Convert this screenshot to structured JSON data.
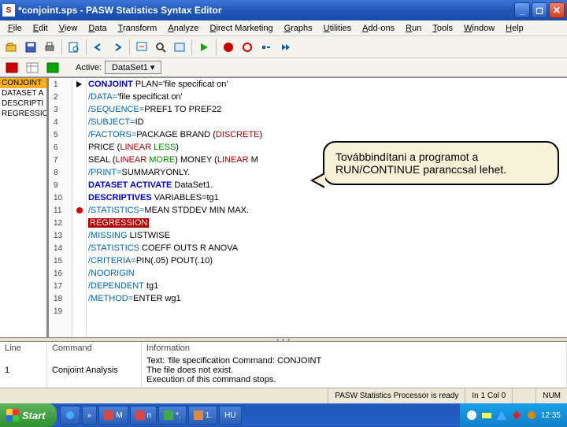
{
  "window": {
    "title": "*conjoint.sps - PASW Statistics Syntax Editor",
    "app_icon_letter": "S"
  },
  "menu": [
    "File",
    "Edit",
    "View",
    "Data",
    "Transform",
    "Analyze",
    "Direct Marketing",
    "Graphs",
    "Utilities",
    "Add-ons",
    "Run",
    "Tools",
    "Window",
    "Help"
  ],
  "toolbar2": {
    "active_label": "Active:",
    "dataset": "DataSet1 ▾"
  },
  "nav": {
    "items": [
      "CONJOINT",
      "DATASET A",
      "DESCRIPTI",
      "REGRESSIO"
    ],
    "selected_index": 0
  },
  "gutter_lines": [
    "1",
    "2",
    "3",
    "4",
    "5",
    "6",
    "7",
    "8",
    "9",
    "10",
    "11",
    "12",
    "13",
    "14",
    "15",
    "16",
    "17",
    "18",
    "19"
  ],
  "code": [
    {
      "indent": 0,
      "segments": [
        {
          "cls": "cmd",
          "t": "CONJOINT"
        },
        {
          "cls": "txt",
          "t": " PLAN='file specificat on'"
        }
      ],
      "marker": "arrow"
    },
    {
      "indent": 1,
      "segments": [
        {
          "cls": "sub",
          "t": "/DATA="
        },
        {
          "cls": "txt",
          "t": "'file specificat on'"
        }
      ]
    },
    {
      "indent": 1,
      "segments": [
        {
          "cls": "sub",
          "t": "/SEQUENCE="
        },
        {
          "cls": "txt",
          "t": "PREF1 TO PREF22"
        }
      ]
    },
    {
      "indent": 1,
      "segments": [
        {
          "cls": "sub",
          "t": "/SUBJECT="
        },
        {
          "cls": "txt",
          "t": "ID"
        }
      ]
    },
    {
      "indent": 1,
      "segments": [
        {
          "cls": "sub",
          "t": "/FACTORS="
        },
        {
          "cls": "txt",
          "t": "PACKAGE BRAND ("
        },
        {
          "cls": "kw",
          "t": "DISCRETE"
        },
        {
          "cls": "txt",
          "t": ")"
        }
      ]
    },
    {
      "indent": 2,
      "segments": [
        {
          "cls": "txt",
          "t": "PRICE ("
        },
        {
          "cls": "kw",
          "t": "LINEAR"
        },
        {
          "cls": "txt",
          "t": " "
        },
        {
          "cls": "val",
          "t": "LESS"
        },
        {
          "cls": "txt",
          "t": ")"
        }
      ]
    },
    {
      "indent": 2,
      "segments": [
        {
          "cls": "txt",
          "t": "SEAL ("
        },
        {
          "cls": "kw",
          "t": "LINEAR"
        },
        {
          "cls": "txt",
          "t": " "
        },
        {
          "cls": "val",
          "t": "MORE"
        },
        {
          "cls": "txt",
          "t": ") MONEY ("
        },
        {
          "cls": "kw",
          "t": "LINEAR"
        },
        {
          "cls": "txt",
          "t": " M"
        }
      ]
    },
    {
      "indent": 1,
      "segments": [
        {
          "cls": "sub",
          "t": "/PRINT="
        },
        {
          "cls": "txt",
          "t": "SUMMARYONLY."
        }
      ]
    },
    {
      "indent": 0,
      "segments": [
        {
          "cls": "cmd",
          "t": "DATASET ACTIVATE"
        },
        {
          "cls": "txt",
          "t": " DataSet1."
        }
      ]
    },
    {
      "indent": 0,
      "segments": [
        {
          "cls": "cmd",
          "t": "DESCRIPTIVES"
        },
        {
          "cls": "txt",
          "t": " VARIABLES=tg1"
        }
      ]
    },
    {
      "indent": 1,
      "segments": [
        {
          "cls": "sub",
          "t": "/STATISTICS="
        },
        {
          "cls": "txt",
          "t": "MEAN STDDEV MIN MAX."
        }
      ],
      "marker": "reddot"
    },
    {
      "indent": 0,
      "segments": [
        {
          "cls": "selred",
          "t": "REGRESSION"
        }
      ]
    },
    {
      "indent": 1,
      "segments": [
        {
          "cls": "sub",
          "t": "/MISSING"
        },
        {
          "cls": "txt",
          "t": " LISTWISE"
        }
      ]
    },
    {
      "indent": 1,
      "segments": [
        {
          "cls": "sub",
          "t": "/STATISTICS"
        },
        {
          "cls": "txt",
          "t": " COEFF OUTS R ANOVA"
        }
      ]
    },
    {
      "indent": 1,
      "segments": [
        {
          "cls": "sub",
          "t": "/CRITERIA="
        },
        {
          "cls": "txt",
          "t": "PIN(.05) POUT(.10)"
        }
      ]
    },
    {
      "indent": 1,
      "segments": [
        {
          "cls": "sub",
          "t": "/NOORIGIN"
        }
      ]
    },
    {
      "indent": 1,
      "segments": [
        {
          "cls": "sub",
          "t": "/DEPENDENT"
        },
        {
          "cls": "txt",
          "t": " tg1"
        }
      ]
    },
    {
      "indent": 1,
      "segments": [
        {
          "cls": "sub",
          "t": "/METHOD="
        },
        {
          "cls": "txt",
          "t": "ENTER wg1"
        }
      ]
    },
    {
      "indent": 0,
      "segments": []
    }
  ],
  "callout": {
    "line1": "Továbbindítani a programot a",
    "line2": "RUN/CONTINUE paranccsal lehet."
  },
  "info": {
    "headers": {
      "line": "Line",
      "command": "Command",
      "information": "Information"
    },
    "row": {
      "line": "1",
      "command": "Conjoint Analysis",
      "info1": "Text: 'file specification Command: CONJOINT",
      "info2": "The file does not exist.",
      "info3": "Execution of this command stops."
    }
  },
  "status": {
    "processor": "PASW Statistics Processor is ready",
    "pos": "In 1 Col 0",
    "num": "NUM"
  },
  "taskbar": {
    "start": "Start",
    "items": [
      "",
      "M",
      "n",
      "*.",
      "1.",
      "HU"
    ],
    "more": "»",
    "clock": "12:35"
  }
}
